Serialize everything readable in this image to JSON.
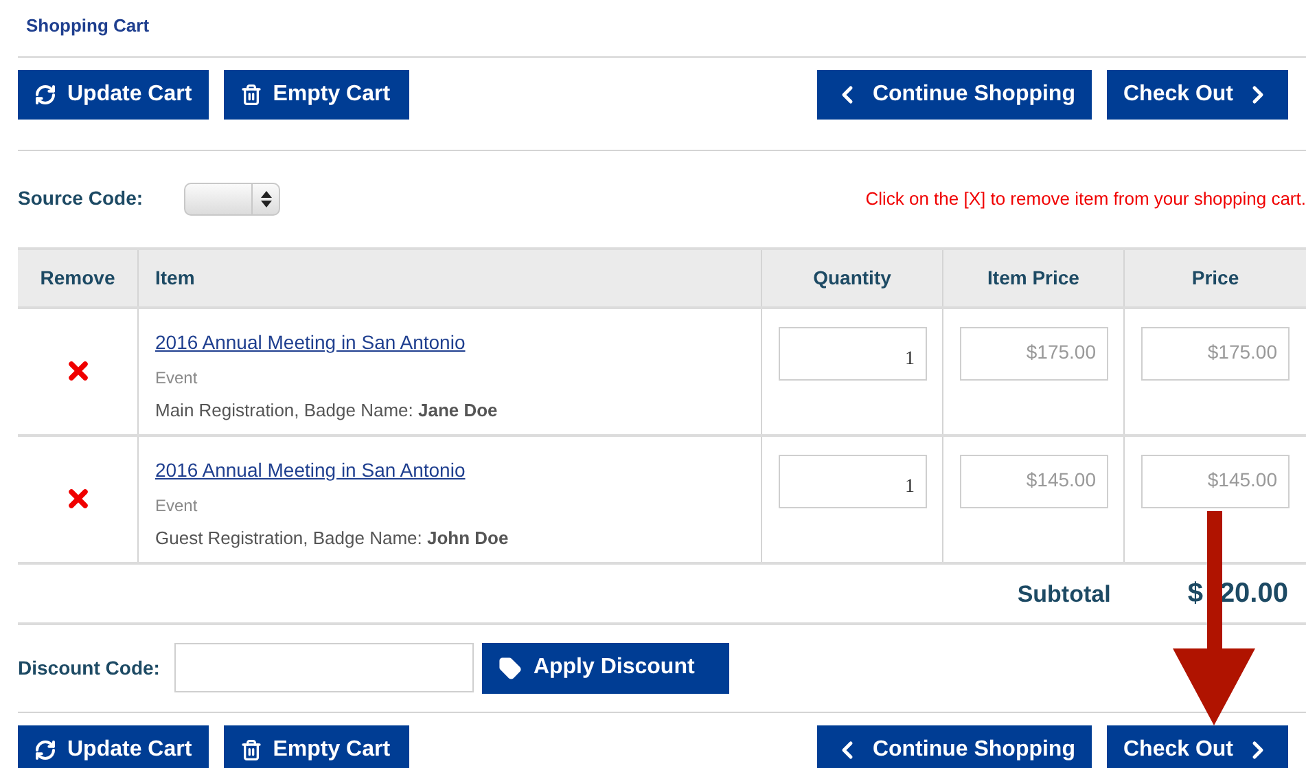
{
  "title": "Shopping Cart",
  "actions_top": [
    {
      "kind": "update",
      "label": "Update Cart"
    },
    {
      "kind": "empty",
      "label": "Empty Cart"
    },
    {
      "kind": "continue",
      "label": "Continue Shopping"
    },
    {
      "kind": "checkout",
      "label": "Check Out"
    }
  ],
  "source_code": {
    "label": "Source Code:"
  },
  "hint": "Click on the [X] to remove item from your shopping cart.",
  "table": {
    "columns": [
      "Remove",
      "Item",
      "Quantity",
      "Item Price",
      "Price"
    ],
    "rows": [
      {
        "item": "2016 Annual Meeting in San Antonio",
        "type": "Event",
        "detail": "Main Registration, Badge Name: **Jane Doe**",
        "quantity": "1",
        "item_price": "$175.00",
        "price": "$175.00"
      },
      {
        "item": "2016 Annual Meeting in San Antonio",
        "type": "Event",
        "detail": "Guest Registration, Badge Name: **John Doe**",
        "quantity": "1",
        "item_price": "$145.00",
        "price": "$145.00"
      }
    ]
  },
  "subtotal": {
    "label": "Subtotal",
    "value_start": "$",
    "value_end": "20.00"
  },
  "discount": {
    "label": "Discount Code:",
    "button": "Apply Discount"
  },
  "actions_bottom": [
    {
      "kind": "update",
      "label": "Update Cart"
    },
    {
      "kind": "empty",
      "label": "Empty Cart"
    },
    {
      "kind": "continue",
      "label": "Continue Shopping"
    },
    {
      "kind": "checkout",
      "label": "Check Out"
    }
  ]
}
